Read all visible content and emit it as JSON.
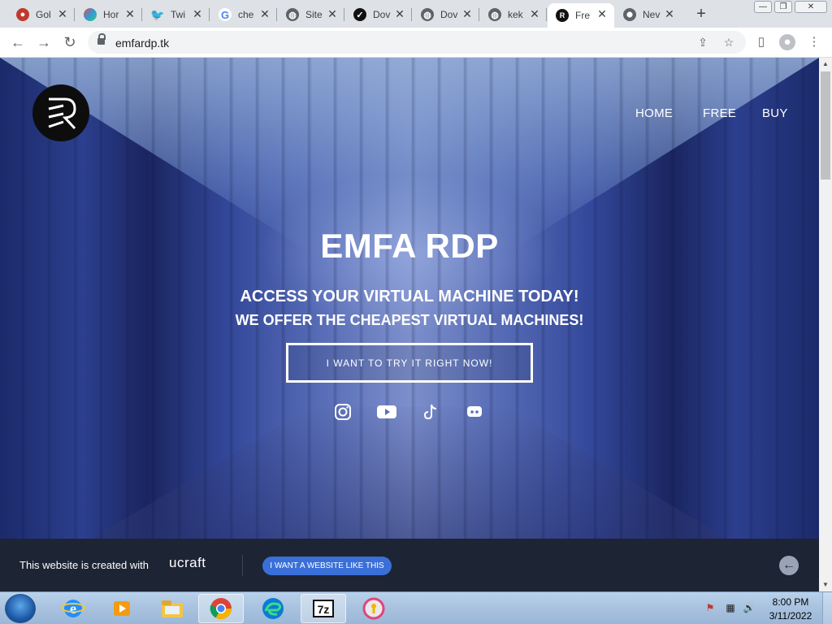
{
  "browser": {
    "tabs": [
      {
        "title": "Gol",
        "favicon": "goldcoin-icon",
        "color": "#c0392b"
      },
      {
        "title": "Hor",
        "favicon": "colorful-heart-icon",
        "color": "#7b4ea3"
      },
      {
        "title": "Twi",
        "favicon": "twitter-icon",
        "color": "#1da1f2"
      },
      {
        "title": "che",
        "favicon": "google-icon",
        "color": "#4285f4"
      },
      {
        "title": "Site",
        "favicon": "globe-icon",
        "color": "#5f6368"
      },
      {
        "title": "Dov",
        "favicon": "check-icon",
        "color": "#111111"
      },
      {
        "title": "Dov",
        "favicon": "globe-icon",
        "color": "#5f6368"
      },
      {
        "title": "kek",
        "favicon": "globe-icon",
        "color": "#5f6368"
      },
      {
        "title": "Fre",
        "favicon": "emfa-logo-icon",
        "color": "#111111",
        "active": true
      },
      {
        "title": "Nev",
        "favicon": "chrome-icon",
        "color": "#5f6368"
      }
    ],
    "url": "emfardp.tk"
  },
  "site": {
    "nav": [
      "HOME",
      "FREE",
      "BUY"
    ],
    "hero_title": "EMFA RDP",
    "hero_subtitle_1": "ACCESS YOUR VIRTUAL MACHINE TODAY!",
    "hero_subtitle_2": "WE OFFER THE CHEAPEST VIRTUAL MACHINES!",
    "cta_label": "I WANT TO TRY IT RIGHT NOW!",
    "socials": [
      "instagram-icon",
      "youtube-icon",
      "tiktok-icon",
      "discord-icon"
    ]
  },
  "banner": {
    "text": "This website is created with",
    "brand": "ucraft",
    "button_label": "I WANT A WEBSITE LIKE THIS"
  },
  "taskbar": {
    "time": "8:00 PM",
    "date": "3/11/2022",
    "apps": [
      "internet-explorer-icon",
      "media-player-icon",
      "file-explorer-icon",
      "chrome-icon",
      "edge-icon",
      "7zip-icon",
      "vpn-icon"
    ]
  }
}
